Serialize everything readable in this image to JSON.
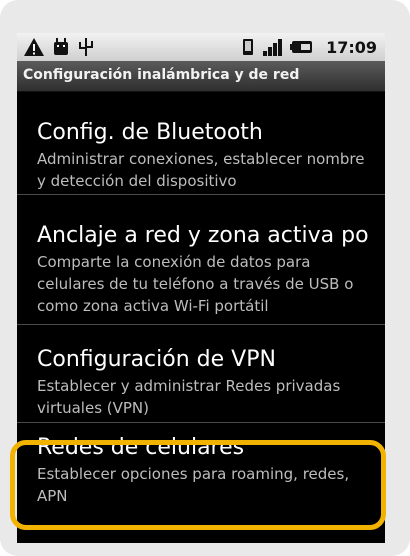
{
  "status_bar": {
    "icons": [
      "warning-icon",
      "android-debug-icon",
      "usb-icon",
      "vibrate-icon",
      "signal-icon",
      "battery-icon"
    ],
    "time": "17:09"
  },
  "header": {
    "title": "Configuración inalámbrica y de red"
  },
  "settings": [
    {
      "title": "Config. de Bluetooth",
      "subtitle": "Administrar conexiones, establecer nombre y detección del dispositivo"
    },
    {
      "title": "Anclaje a red y zona activa po",
      "subtitle": "Comparte la conexión de datos para celulares de tu teléfono a través de USB o como zona activa Wi-Fi portátil"
    },
    {
      "title": "Configuración de VPN",
      "subtitle": "Establecer y administrar Redes privadas virtuales (VPN)"
    },
    {
      "title": "Redes de celulares",
      "subtitle": "Establecer opciones para roaming, redes, APN",
      "highlighted": true
    }
  ],
  "colors": {
    "highlight": "#f2b300",
    "background": "#000000"
  }
}
